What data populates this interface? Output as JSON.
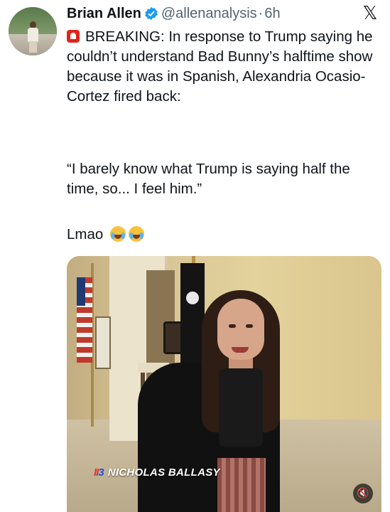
{
  "tweet": {
    "author_name": "Brian Allen",
    "handle": "@allenanalysis",
    "separator": "·",
    "time": "6h",
    "paragraph1": "BREAKING: In response to Trump saying he couldn’t understand Bad Bunny’s halftime show because it was in Spanish, Alexandria Ocasio-Cortez fired back:",
    "paragraph2": "“I barely know what Trump is saying half the time, so... I feel him.”",
    "paragraph3": "Lmao",
    "icons": {
      "siren": "police-light-icon",
      "emoji1": "loudly-crying-face-icon",
      "emoji2": "face-with-tears-of-joy-icon",
      "verified": "verified-badge-icon",
      "platform": "x-logo-icon",
      "mute": "volume-muted-icon"
    },
    "colors": {
      "verified": "#1d9bf0",
      "text": "#0f1419",
      "secondary": "#536471"
    }
  },
  "media": {
    "credit_logo_prefix": "II",
    "credit_logo_suffix": "3",
    "credit_name": "NICHOLAS BALLASY"
  },
  "platform_logo_text": "𝕏"
}
